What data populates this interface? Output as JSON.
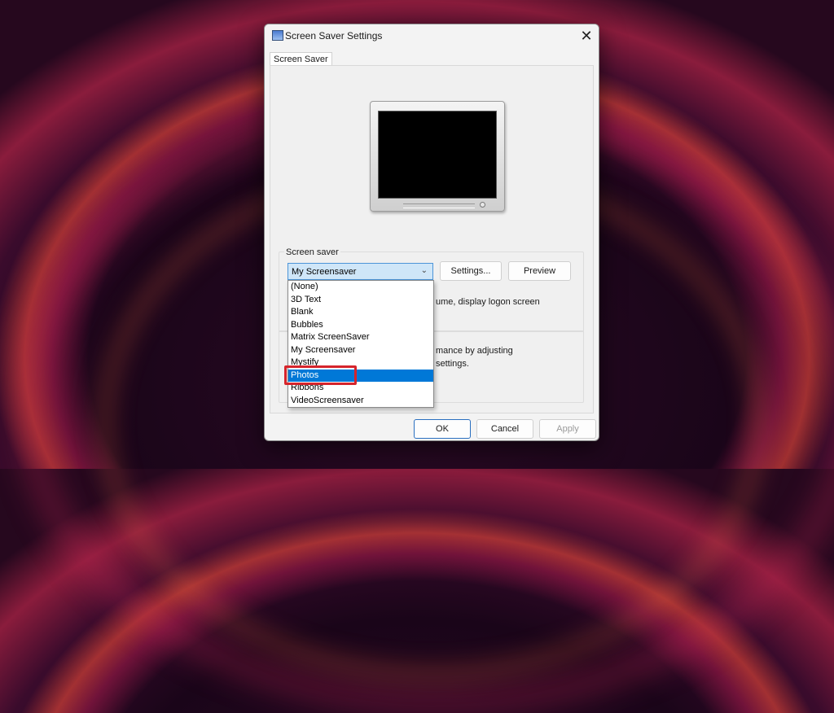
{
  "window": {
    "title": "Screen Saver Settings",
    "close_glyph": "✕"
  },
  "tabs": [
    {
      "label": "Screen Saver"
    }
  ],
  "screen_saver": {
    "group_label": "Screen saver",
    "selected": "My Screensaver",
    "settings_label": "Settings...",
    "preview_label": "Preview",
    "logon_text": "ume, display logon screen",
    "power_text_1": "mance by adjusting",
    "power_text_2": "settings."
  },
  "dropdown": {
    "options": [
      "(None)",
      "3D Text",
      "Blank",
      "Bubbles",
      "Matrix ScreenSaver",
      "My Screensaver",
      "Mystify",
      "Photos",
      "Ribbons",
      "VideoScreensaver"
    ],
    "highlighted": "Photos"
  },
  "footer": {
    "ok": "OK",
    "cancel": "Cancel",
    "apply": "Apply"
  },
  "colors": {
    "accent": "#0078d7",
    "callout": "#d6242b"
  }
}
